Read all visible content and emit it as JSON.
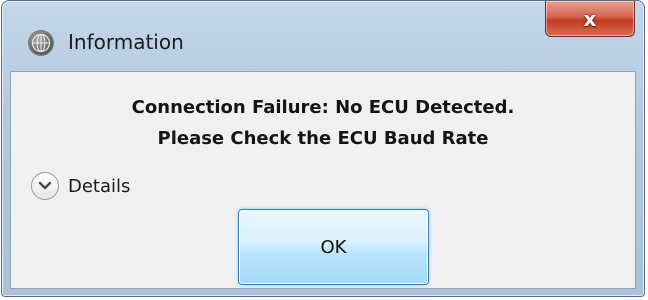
{
  "window": {
    "title": "Information",
    "title_icon": "info-globe-icon",
    "close_label": "x"
  },
  "dialog": {
    "message_line1": "Connection Failure: No ECU Detected.",
    "message_line2": "Please Check the ECU Baud Rate",
    "details_label": "Details",
    "ok_label": "OK"
  },
  "colors": {
    "close_button": "#c13b22",
    "ok_button_border": "#3c7fb1",
    "frame": "#b3c9df"
  }
}
